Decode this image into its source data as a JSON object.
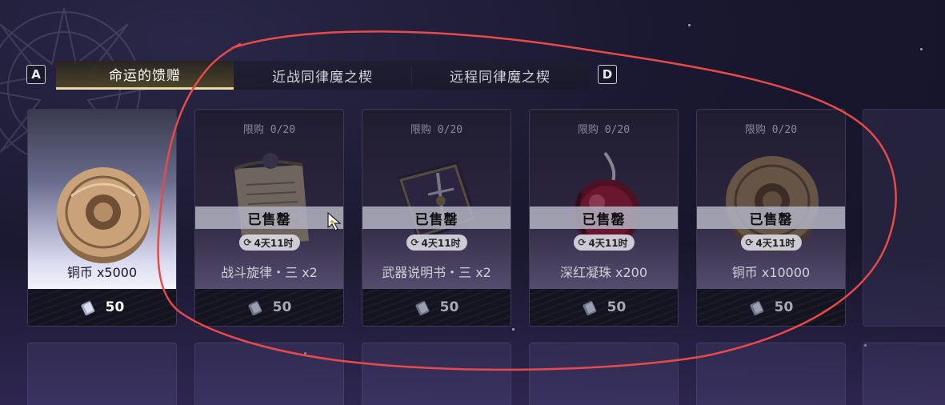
{
  "tabs": {
    "key_left": "A",
    "key_right": "D",
    "items": [
      {
        "label": "命运的馈赠",
        "active": true
      },
      {
        "label": "近战同律魔之楔",
        "active": false
      },
      {
        "label": "远程同律魔之楔",
        "active": false
      }
    ]
  },
  "shop": {
    "items": [
      {
        "name": "铜币 x5000",
        "price": "50",
        "limit": "",
        "sold": false,
        "icon": "coin-icon"
      },
      {
        "name": "战斗旋律・三 x2",
        "price": "50",
        "limit": "限购 0/20",
        "sold_label": "已售罄",
        "timer": "4天11时",
        "sold": true,
        "icon": "scroll-icon"
      },
      {
        "name": "武器说明书・三 x2",
        "price": "50",
        "limit": "限购 0/20",
        "sold_label": "已售罄",
        "timer": "4天11时",
        "sold": true,
        "icon": "book-icon"
      },
      {
        "name": "深红凝珠 x200",
        "price": "50",
        "limit": "限购 0/20",
        "sold_label": "已售罄",
        "timer": "4天11时",
        "sold": true,
        "icon": "crimson-orb-icon"
      },
      {
        "name": "铜币 x10000",
        "price": "50",
        "limit": "限购 0/20",
        "sold_label": "已售罄",
        "timer": "4天11时",
        "sold": true,
        "icon": "coin-icon"
      }
    ]
  },
  "colors": {
    "accent_tab": "#e9d9a2",
    "annotation": "#e84a4a"
  }
}
